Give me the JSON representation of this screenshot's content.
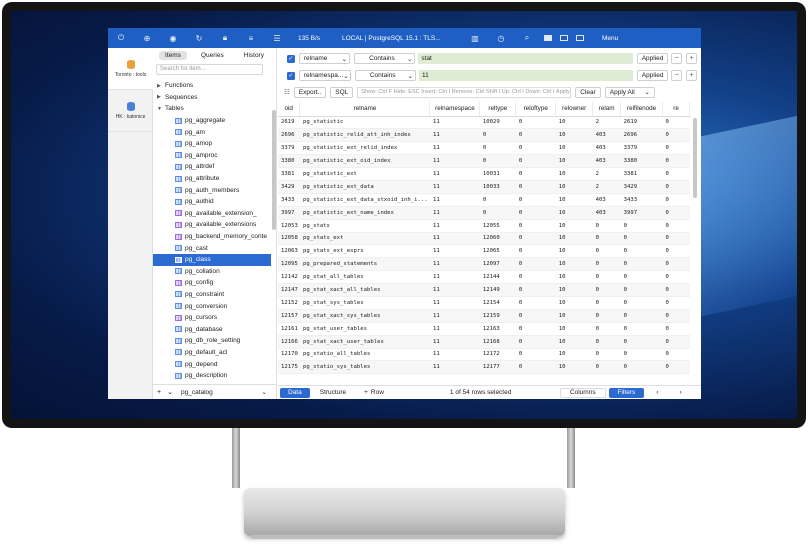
{
  "toolbar": {
    "rate": "135 B/s",
    "connection": "LOCAL | PostgreSQL 15.1 : TLS...",
    "menu_label": "Menu",
    "icons": [
      "power-icon",
      "add-icon",
      "eye-icon",
      "refresh-icon",
      "lock-icon",
      "database-icon",
      "list-icon",
      "chart-icon",
      "history-icon",
      "search-icon"
    ]
  },
  "rail": [
    {
      "label": "Toronto : tools"
    },
    {
      "label": "HK : katonice"
    }
  ],
  "sidebar": {
    "tabs": [
      "Items",
      "Queries",
      "History"
    ],
    "search_placeholder": "Search for item...",
    "groups": [
      "Functions",
      "Sequences",
      "Tables"
    ],
    "tables": [
      {
        "name": "pg_aggregate",
        "view": false
      },
      {
        "name": "pg_am",
        "view": false
      },
      {
        "name": "pg_amop",
        "view": false
      },
      {
        "name": "pg_amproc",
        "view": false
      },
      {
        "name": "pg_attrdef",
        "view": false
      },
      {
        "name": "pg_attribute",
        "view": false
      },
      {
        "name": "pg_auth_members",
        "view": false
      },
      {
        "name": "pg_authid",
        "view": false
      },
      {
        "name": "pg_available_extension_",
        "view": true
      },
      {
        "name": "pg_available_extensions",
        "view": true
      },
      {
        "name": "pg_backend_memory_conte",
        "view": true
      },
      {
        "name": "pg_cast",
        "view": false
      },
      {
        "name": "pg_class",
        "view": false
      },
      {
        "name": "pg_collation",
        "view": false
      },
      {
        "name": "pg_config",
        "view": true
      },
      {
        "name": "pg_constraint",
        "view": false
      },
      {
        "name": "pg_conversion",
        "view": false
      },
      {
        "name": "pg_cursors",
        "view": true
      },
      {
        "name": "pg_database",
        "view": false
      },
      {
        "name": "pg_db_role_setting",
        "view": false
      },
      {
        "name": "pg_default_acl",
        "view": false
      },
      {
        "name": "pg_depend",
        "view": false
      },
      {
        "name": "pg_description",
        "view": false
      }
    ],
    "selected": "pg_class",
    "schema": "pg_catalog"
  },
  "filters": [
    {
      "column": "relname",
      "operator": "Contains",
      "value": "stat",
      "applied_label": "Applied"
    },
    {
      "column": "relnamespa...",
      "operator": "Contains",
      "value": "11",
      "applied_label": "Applied"
    }
  ],
  "actions": {
    "export": "Export..",
    "sql": "SQL",
    "hint": "Show: Ctrl F Hide: ESC Insert: Ctrl I Remove: Ctrl Shift I Up: Ctrl I Down: Ctrl I Apply: Ent...",
    "clear": "Clear",
    "apply_all": "Apply All"
  },
  "grid": {
    "columns": [
      "oid",
      "relname",
      "relnamespace",
      "reltype",
      "reloftype",
      "relowner",
      "relam",
      "relfilenode",
      "re"
    ],
    "rows": [
      [
        "2619",
        "pg_statistic",
        "11",
        "10029",
        "0",
        "10",
        "2",
        "2619",
        "0"
      ],
      [
        "2696",
        "pg_statistic_relid_att_inh_index",
        "11",
        "0",
        "0",
        "10",
        "403",
        "2696",
        "0"
      ],
      [
        "3379",
        "pg_statistic_ext_relid_index",
        "11",
        "0",
        "0",
        "10",
        "403",
        "3379",
        "0"
      ],
      [
        "3380",
        "pg_statistic_ext_oid_index",
        "11",
        "0",
        "0",
        "10",
        "403",
        "3380",
        "0"
      ],
      [
        "3381",
        "pg_statistic_ext",
        "11",
        "10031",
        "0",
        "10",
        "2",
        "3381",
        "0"
      ],
      [
        "3429",
        "pg_statistic_ext_data",
        "11",
        "10033",
        "0",
        "10",
        "2",
        "3429",
        "0"
      ],
      [
        "3433",
        "pg_statistic_ext_data_stxoid_inh_i...",
        "11",
        "0",
        "0",
        "10",
        "403",
        "3433",
        "0"
      ],
      [
        "3997",
        "pg_statistic_ext_name_index",
        "11",
        "0",
        "0",
        "10",
        "403",
        "3997",
        "0"
      ],
      [
        "12053",
        "pg_stats",
        "11",
        "12055",
        "0",
        "10",
        "0",
        "0",
        "0"
      ],
      [
        "12058",
        "pg_stats_ext",
        "11",
        "12060",
        "0",
        "10",
        "0",
        "0",
        "0"
      ],
      [
        "12063",
        "pg_stats_ext_exprs",
        "11",
        "12065",
        "0",
        "10",
        "0",
        "0",
        "0"
      ],
      [
        "12095",
        "pg_prepared_statements",
        "11",
        "12097",
        "0",
        "10",
        "0",
        "0",
        "0"
      ],
      [
        "12142",
        "pg_stat_all_tables",
        "11",
        "12144",
        "0",
        "10",
        "0",
        "0",
        "0"
      ],
      [
        "12147",
        "pg_stat_xact_all_tables",
        "11",
        "12149",
        "0",
        "10",
        "0",
        "0",
        "0"
      ],
      [
        "12152",
        "pg_stat_sys_tables",
        "11",
        "12154",
        "0",
        "10",
        "0",
        "0",
        "0"
      ],
      [
        "12157",
        "pg_stat_xact_sys_tables",
        "11",
        "12159",
        "0",
        "10",
        "0",
        "0",
        "0"
      ],
      [
        "12161",
        "pg_stat_user_tables",
        "11",
        "12163",
        "0",
        "10",
        "0",
        "0",
        "0"
      ],
      [
        "12166",
        "pg_stat_xact_user_tables",
        "11",
        "12168",
        "0",
        "10",
        "0",
        "0",
        "0"
      ],
      [
        "12170",
        "pg_statio_all_tables",
        "11",
        "12172",
        "0",
        "10",
        "0",
        "0",
        "0"
      ],
      [
        "12175",
        "pg_statio_sys_tables",
        "11",
        "12177",
        "0",
        "10",
        "0",
        "0",
        "0"
      ]
    ]
  },
  "status": {
    "tab_data": "Data",
    "tab_structure": "Structure",
    "add_row": "Row",
    "info": "1 of 54 rows selected",
    "columns": "Columns",
    "filters": "Filters"
  },
  "colors": {
    "accent": "#2b6ad0",
    "toolbar": "#1f5fc4",
    "filter_value": "#ddecd3"
  }
}
